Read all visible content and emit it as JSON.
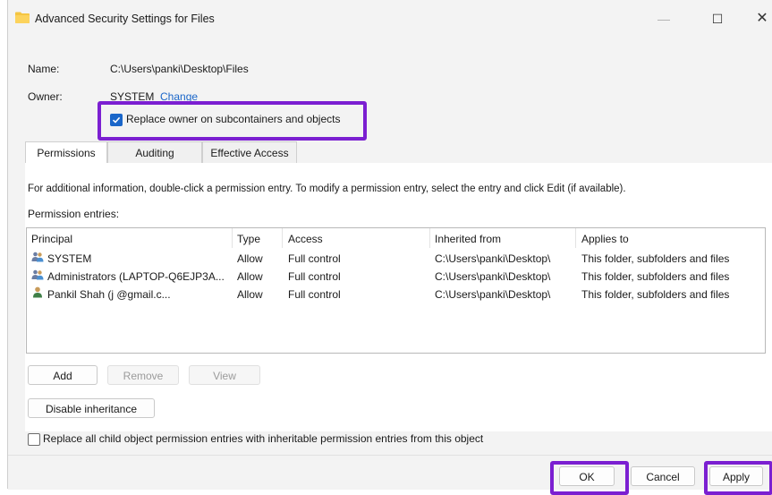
{
  "window": {
    "title": "Advanced Security Settings for Files",
    "minimize_glyph": "—",
    "maximize_glyph": "☐",
    "close_glyph": "✕"
  },
  "header": {
    "name_label": "Name:",
    "name_value": "C:\\Users\\panki\\Desktop\\Files",
    "owner_label": "Owner:",
    "owner_value": "SYSTEM",
    "change_link": "Change",
    "replace_owner_label": "Replace owner on subcontainers and objects",
    "replace_owner_checked": true
  },
  "tabs": [
    {
      "label": "Permissions",
      "active": true
    },
    {
      "label": "Auditing",
      "active": false
    },
    {
      "label": "Effective Access",
      "active": false
    }
  ],
  "permissions": {
    "info_text": "For additional information, double-click a permission entry. To modify a permission entry, select the entry and click Edit (if available).",
    "entries_label": "Permission entries:",
    "columns": [
      "Principal",
      "Type",
      "Access",
      "Inherited from",
      "Applies to"
    ],
    "rows": [
      {
        "icon": "group-users-icon",
        "principal": "SYSTEM",
        "type": "Allow",
        "access": "Full control",
        "inherited_from": "C:\\Users\\panki\\Desktop\\",
        "applies_to": "This folder, subfolders and files"
      },
      {
        "icon": "group-users-icon",
        "principal": "Administrators (LAPTOP-Q6EJP3A...",
        "type": "Allow",
        "access": "Full control",
        "inherited_from": "C:\\Users\\panki\\Desktop\\",
        "applies_to": "This folder, subfolders and files"
      },
      {
        "icon": "user-icon",
        "principal": "Pankil Shah (j                @gmail.c...",
        "type": "Allow",
        "access": "Full control",
        "inherited_from": "C:\\Users\\panki\\Desktop\\",
        "applies_to": "This folder, subfolders and files"
      }
    ],
    "add_label": "Add",
    "remove_label": "Remove",
    "view_label": "View",
    "disable_inheritance_label": "Disable inheritance",
    "replace_child_label": "Replace all child object permission entries with inheritable permission entries from this object",
    "replace_child_checked": false
  },
  "footer": {
    "ok_label": "OK",
    "cancel_label": "Cancel",
    "apply_label": "Apply"
  },
  "colors": {
    "highlight": "#7b1fd1",
    "accent": "#1a66c9"
  }
}
